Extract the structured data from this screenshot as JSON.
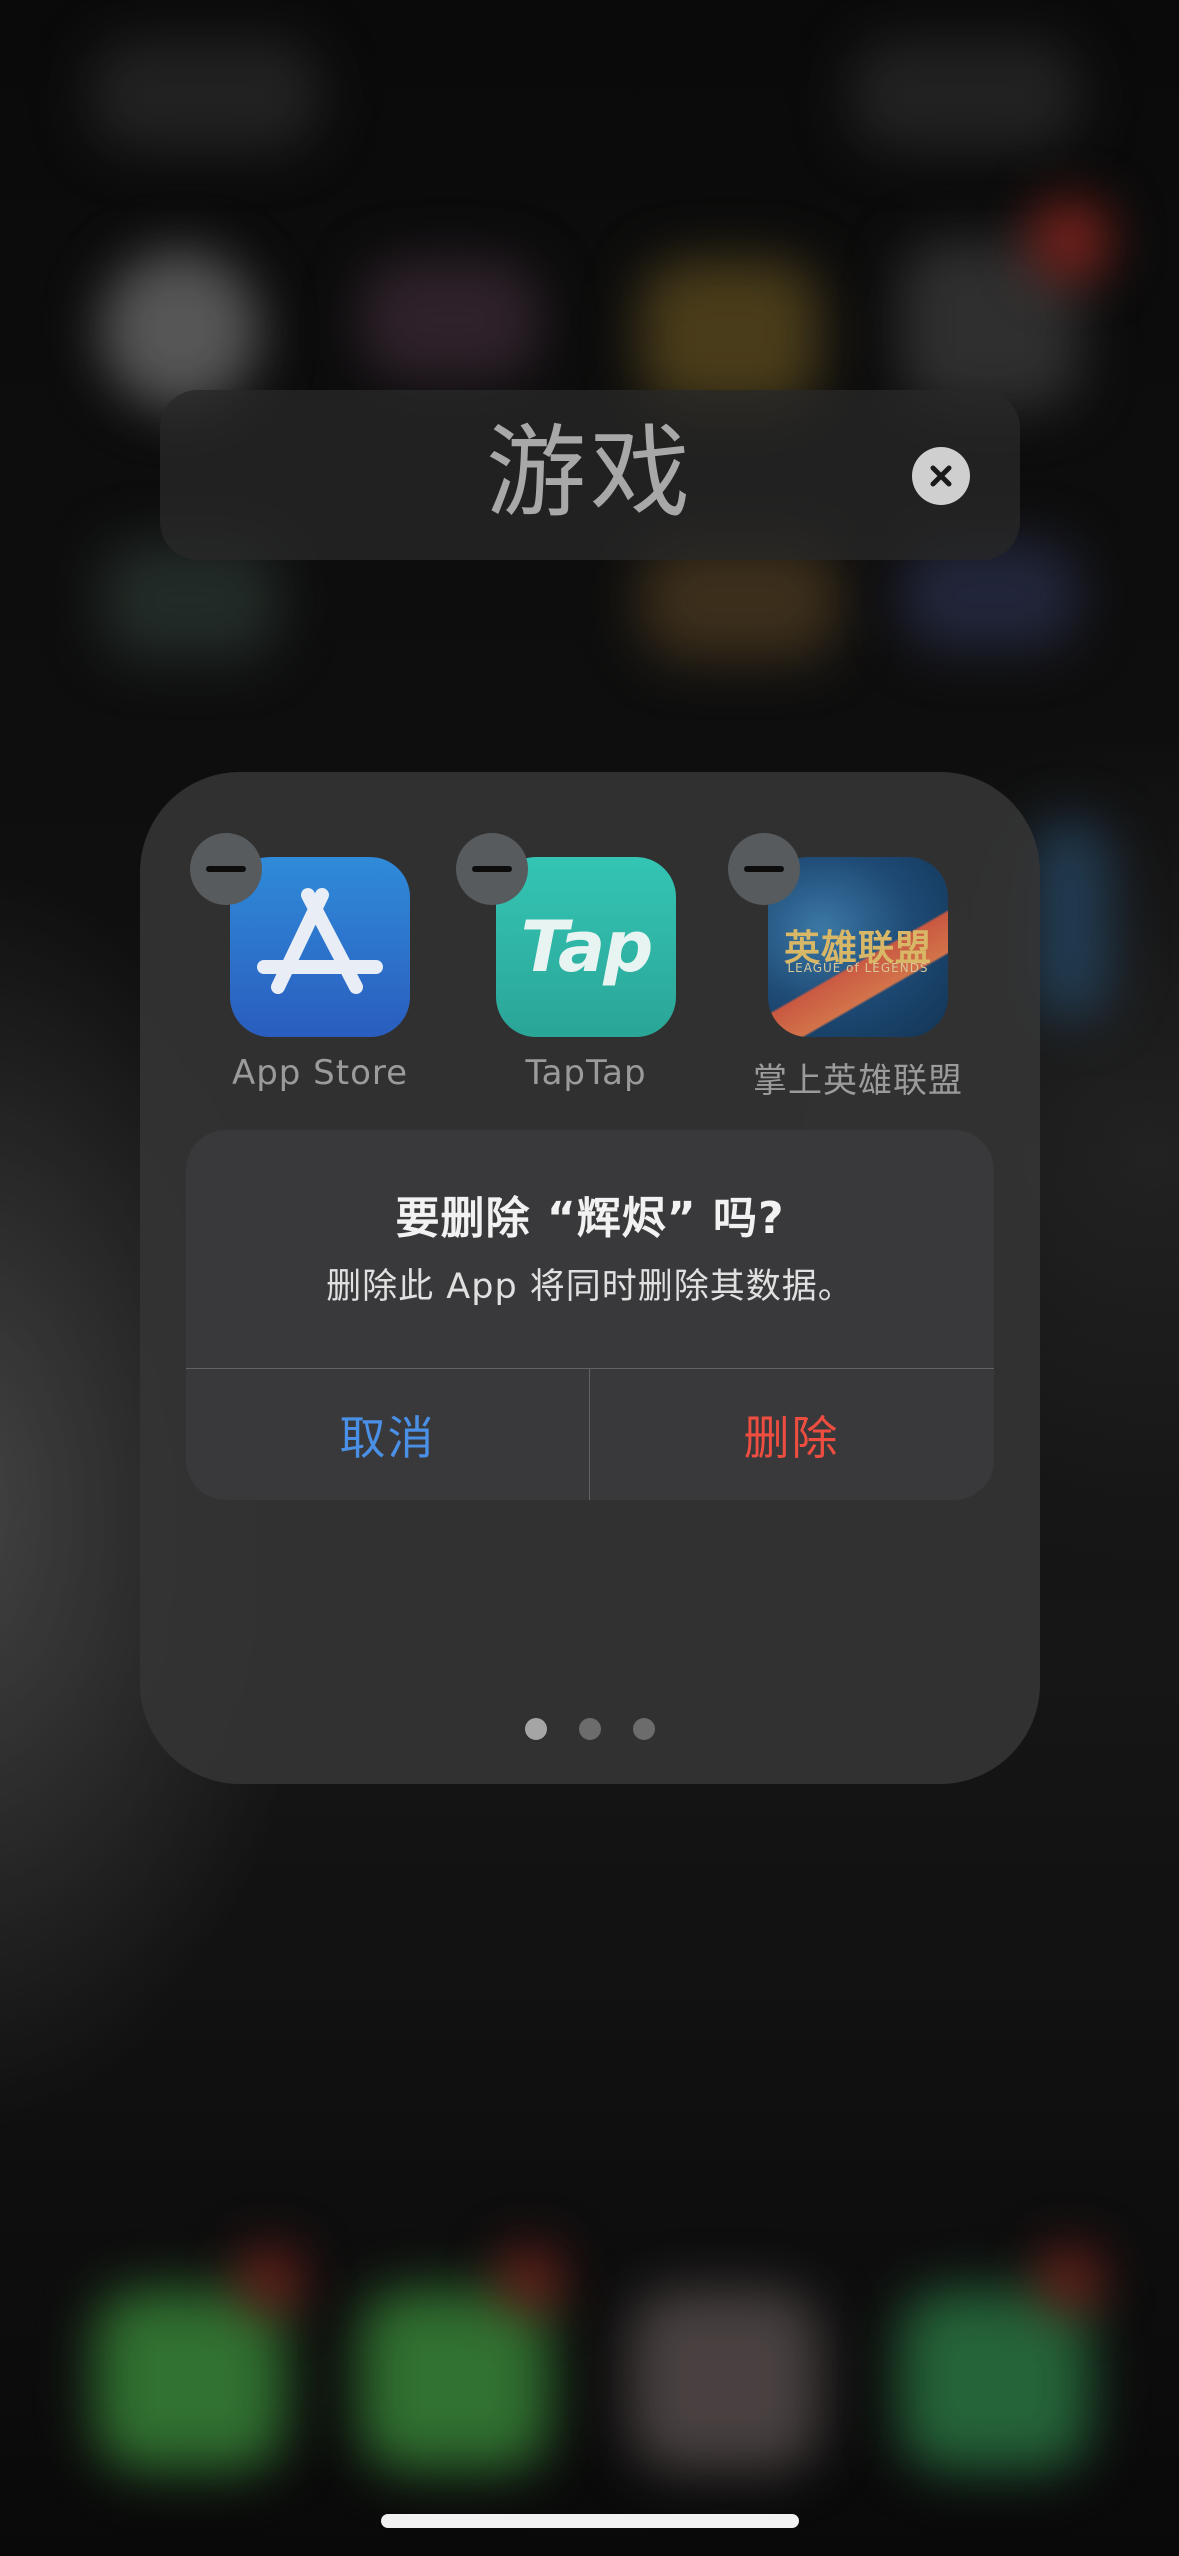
{
  "folder": {
    "title": "游戏",
    "apps": [
      {
        "name": "App Store",
        "icon": "app-store-icon"
      },
      {
        "name": "TapTap",
        "icon": "taptap-icon",
        "icon_text": "Tap"
      },
      {
        "name": "掌上英雄联盟",
        "icon": "league-of-legends-icon",
        "icon_text": "英雄联盟",
        "icon_subtext": "LEAGUE of LEGENDS"
      }
    ],
    "pages": {
      "count": 3,
      "current": 1
    }
  },
  "alert": {
    "title": "要删除 “辉烬” 吗?",
    "message": "删除此 App 将同时删除其数据。",
    "cancel_label": "取消",
    "delete_label": "删除"
  },
  "colors": {
    "cancel": "#4a90e6",
    "delete": "#ee4d40"
  }
}
